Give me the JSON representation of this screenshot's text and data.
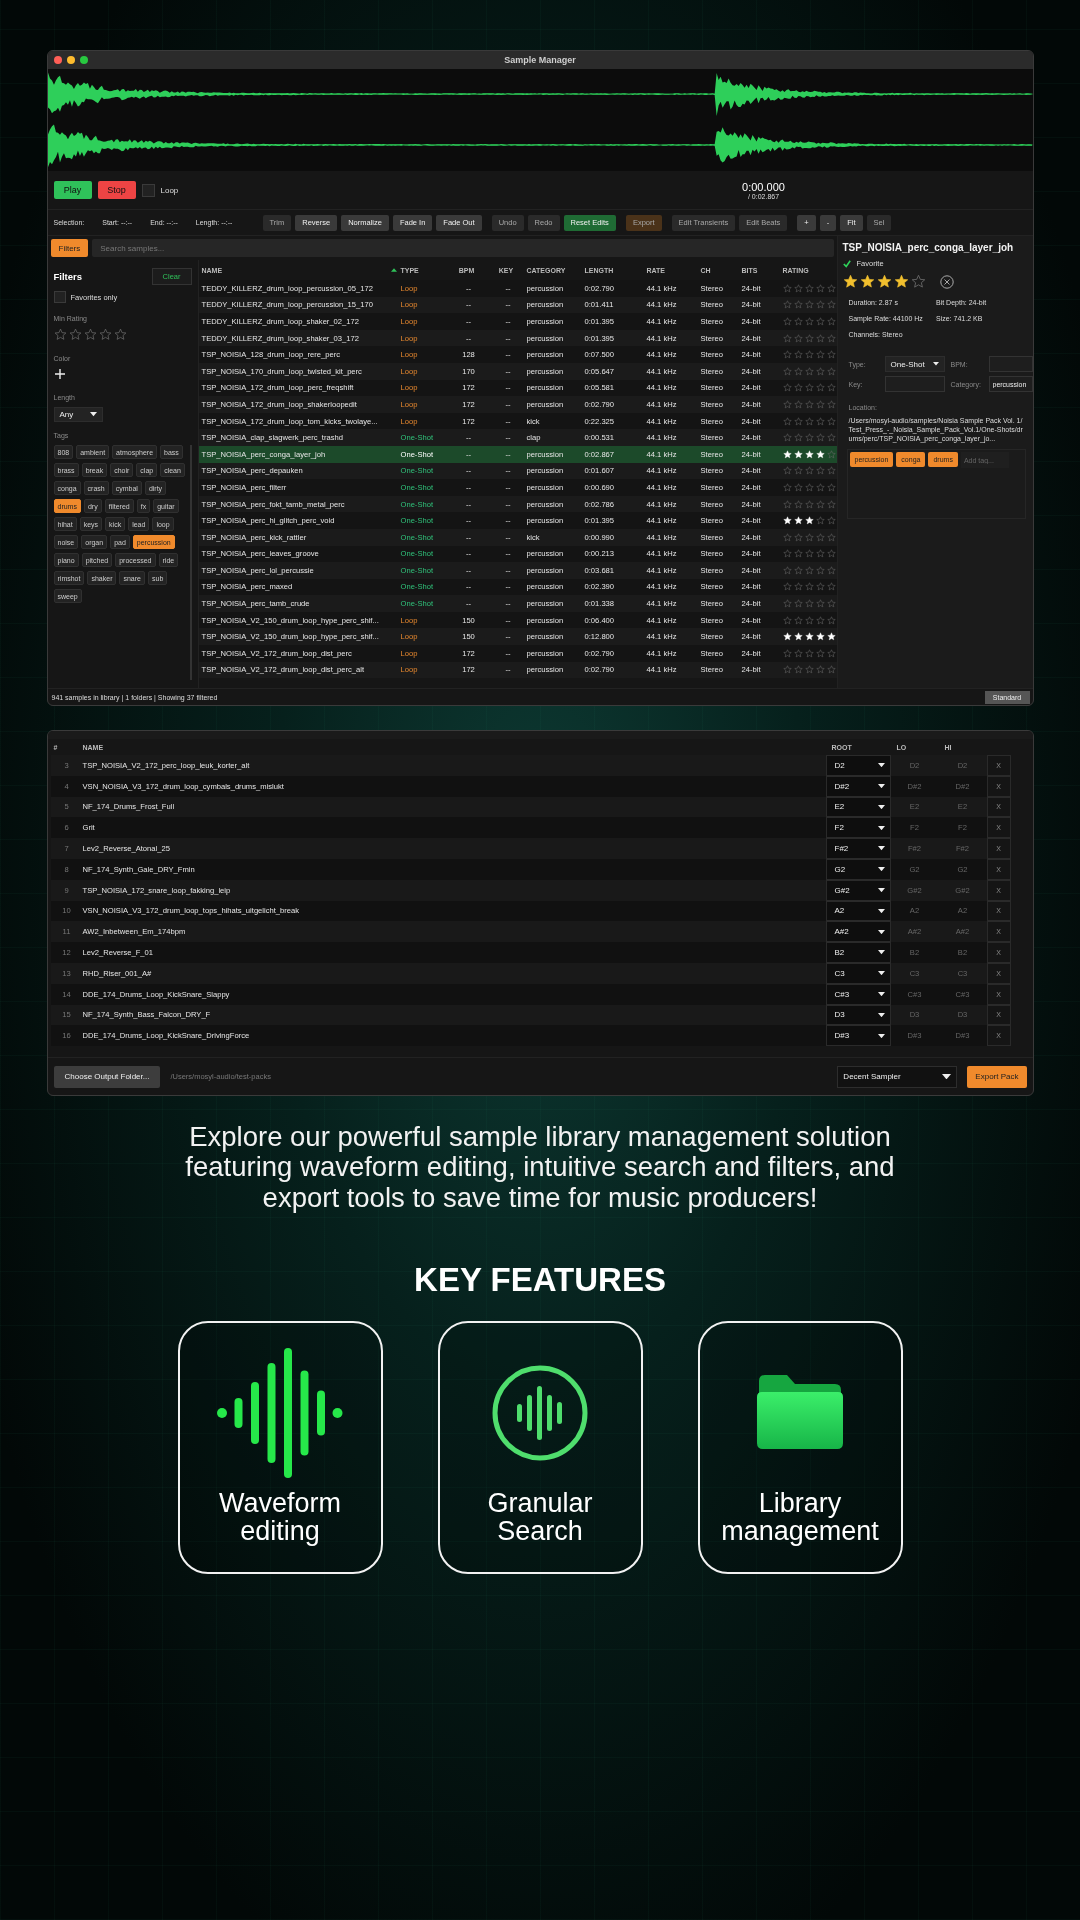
{
  "app": {
    "title": "Sample Manager",
    "transport": {
      "play": "Play",
      "stop": "Stop",
      "loop": {
        "label": "Loop",
        "checked": false
      },
      "time": "0:00.000",
      "duration": "/ 0:02.867"
    },
    "selection": {
      "label": "Selection:",
      "start": "Start: --:--",
      "end": "End: --:--",
      "length": "Length: --:--"
    },
    "tool_groups": [
      [
        {
          "label": "Trim",
          "kind": "plain",
          "disabled": true
        },
        {
          "label": "Reverse",
          "kind": "plain",
          "disabled": false
        },
        {
          "label": "Normalize",
          "kind": "plain",
          "disabled": false
        },
        {
          "label": "Fade In",
          "kind": "plain",
          "disabled": false
        },
        {
          "label": "Fade Out",
          "kind": "plain",
          "disabled": false
        }
      ],
      [
        {
          "label": "Undo",
          "kind": "plain",
          "disabled": true
        },
        {
          "label": "Redo",
          "kind": "plain",
          "disabled": true
        },
        {
          "label": "Reset Edits",
          "kind": "success",
          "disabled": false
        }
      ],
      [
        {
          "label": "Export",
          "kind": "warning",
          "disabled": true
        }
      ],
      [
        {
          "label": "Edit Transients",
          "kind": "plain",
          "disabled": true
        },
        {
          "label": "Edit Beats",
          "kind": "plain",
          "disabled": true
        }
      ],
      [
        {
          "label": "+",
          "kind": "plain",
          "disabled": false
        },
        {
          "label": "-",
          "kind": "plain",
          "disabled": false
        },
        {
          "label": "Fit",
          "kind": "plain",
          "disabled": false
        },
        {
          "label": "Sel",
          "kind": "plain",
          "disabled": true
        }
      ]
    ],
    "filters_button": "Filters",
    "search": {
      "placeholder": "Search samples..."
    },
    "sidebar": {
      "title": "Filters",
      "clear": "Clear",
      "favorites": {
        "label": "Favorites only",
        "checked": false
      },
      "min_rating": {
        "label": "Min Rating",
        "stars": 0
      },
      "color": {
        "label": "Color"
      },
      "length": {
        "label": "Length",
        "value": "Any"
      },
      "tags_label": "Tags",
      "tags": [
        {
          "label": "808",
          "selected": false
        },
        {
          "label": "ambient",
          "selected": false
        },
        {
          "label": "atmosphere",
          "selected": false
        },
        {
          "label": "bass",
          "selected": false
        },
        {
          "label": "brass",
          "selected": false
        },
        {
          "label": "break",
          "selected": false
        },
        {
          "label": "choir",
          "selected": false
        },
        {
          "label": "clap",
          "selected": false
        },
        {
          "label": "clean",
          "selected": false
        },
        {
          "label": "conga",
          "selected": false
        },
        {
          "label": "crash",
          "selected": false
        },
        {
          "label": "cymbal",
          "selected": false
        },
        {
          "label": "dirty",
          "selected": false
        },
        {
          "label": "drums",
          "selected": true
        },
        {
          "label": "dry",
          "selected": false
        },
        {
          "label": "filtered",
          "selected": false
        },
        {
          "label": "fx",
          "selected": false
        },
        {
          "label": "guitar",
          "selected": false
        },
        {
          "label": "hihat",
          "selected": false
        },
        {
          "label": "keys",
          "selected": false
        },
        {
          "label": "kick",
          "selected": false
        },
        {
          "label": "lead",
          "selected": false
        },
        {
          "label": "loop",
          "selected": false
        },
        {
          "label": "noise",
          "selected": false
        },
        {
          "label": "organ",
          "selected": false
        },
        {
          "label": "pad",
          "selected": false
        },
        {
          "label": "percussion",
          "selected": true
        },
        {
          "label": "piano",
          "selected": false
        },
        {
          "label": "pitched",
          "selected": false
        },
        {
          "label": "processed",
          "selected": false
        },
        {
          "label": "ride",
          "selected": false
        },
        {
          "label": "rimshot",
          "selected": false
        },
        {
          "label": "shaker",
          "selected": false
        },
        {
          "label": "snare",
          "selected": false
        },
        {
          "label": "sub",
          "selected": false
        },
        {
          "label": "sweep",
          "selected": false
        }
      ]
    },
    "table": {
      "columns": [
        {
          "label": "NAME",
          "sorted": true
        },
        {
          "label": "TYPE",
          "sorted": false
        },
        {
          "label": "BPM",
          "sorted": false
        },
        {
          "label": "KEY",
          "sorted": false
        },
        {
          "label": "CATEGORY",
          "sorted": false
        },
        {
          "label": "LENGTH",
          "sorted": false
        },
        {
          "label": "RATE",
          "sorted": false
        },
        {
          "label": "CH",
          "sorted": false
        },
        {
          "label": "BITS",
          "sorted": false
        },
        {
          "label": "RATING",
          "sorted": false
        }
      ],
      "rows": [
        {
          "name": "TEDDY_KILLERZ_drum_loop_percussion_05_172",
          "type": "Loop",
          "kind": "loop",
          "bpm": "--",
          "key": "--",
          "category": "percussion",
          "length": "0:02.790",
          "rate": "44.1 kHz",
          "ch": "Stereo",
          "bits": "24-bit",
          "stars": 0,
          "selected": false
        },
        {
          "name": "TEDDY_KILLERZ_drum_loop_percussion_15_170",
          "type": "Loop",
          "kind": "loop",
          "bpm": "--",
          "key": "--",
          "category": "percussion",
          "length": "0:01.411",
          "rate": "44.1 kHz",
          "ch": "Stereo",
          "bits": "24-bit",
          "stars": 0,
          "selected": false
        },
        {
          "name": "TEDDY_KILLERZ_drum_loop_shaker_02_172",
          "type": "Loop",
          "kind": "loop",
          "bpm": "--",
          "key": "--",
          "category": "percussion",
          "length": "0:01.395",
          "rate": "44.1 kHz",
          "ch": "Stereo",
          "bits": "24-bit",
          "stars": 0,
          "selected": false
        },
        {
          "name": "TEDDY_KILLERZ_drum_loop_shaker_03_172",
          "type": "Loop",
          "kind": "loop",
          "bpm": "--",
          "key": "--",
          "category": "percussion",
          "length": "0:01.395",
          "rate": "44.1 kHz",
          "ch": "Stereo",
          "bits": "24-bit",
          "stars": 0,
          "selected": false
        },
        {
          "name": "TSP_NOISIA_128_drum_loop_rere_perc",
          "type": "Loop",
          "kind": "loop",
          "bpm": "128",
          "key": "--",
          "category": "percussion",
          "length": "0:07.500",
          "rate": "44.1 kHz",
          "ch": "Stereo",
          "bits": "24-bit",
          "stars": 0,
          "selected": false
        },
        {
          "name": "TSP_NOISIA_170_drum_loop_twisted_kit_perc",
          "type": "Loop",
          "kind": "loop",
          "bpm": "170",
          "key": "--",
          "category": "percussion",
          "length": "0:05.647",
          "rate": "44.1 kHz",
          "ch": "Stereo",
          "bits": "24-bit",
          "stars": 0,
          "selected": false
        },
        {
          "name": "TSP_NOISIA_172_drum_loop_perc_freqshift",
          "type": "Loop",
          "kind": "loop",
          "bpm": "172",
          "key": "--",
          "category": "percussion",
          "length": "0:05.581",
          "rate": "44.1 kHz",
          "ch": "Stereo",
          "bits": "24-bit",
          "stars": 0,
          "selected": false
        },
        {
          "name": "TSP_NOISIA_172_drum_loop_shakerloopedit",
          "type": "Loop",
          "kind": "loop",
          "bpm": "172",
          "key": "--",
          "category": "percussion",
          "length": "0:02.790",
          "rate": "44.1 kHz",
          "ch": "Stereo",
          "bits": "24-bit",
          "stars": 0,
          "selected": false
        },
        {
          "name": "TSP_NOISIA_172_drum_loop_tom_kicks_twolaye...",
          "type": "Loop",
          "kind": "loop",
          "bpm": "172",
          "key": "--",
          "category": "kick",
          "length": "0:22.325",
          "rate": "44.1 kHz",
          "ch": "Stereo",
          "bits": "24-bit",
          "stars": 0,
          "selected": false
        },
        {
          "name": "TSP_NOISIA_clap_slagwerk_perc_trashd",
          "type": "One-Shot",
          "kind": "one-shot",
          "bpm": "--",
          "key": "--",
          "category": "clap",
          "length": "0:00.531",
          "rate": "44.1 kHz",
          "ch": "Stereo",
          "bits": "24-bit",
          "stars": 0,
          "selected": false
        },
        {
          "name": "TSP_NOISIA_perc_conga_layer_joh",
          "type": "One-Shot",
          "kind": "one-shot",
          "bpm": "--",
          "key": "--",
          "category": "percussion",
          "length": "0:02.867",
          "rate": "44.1 kHz",
          "ch": "Stereo",
          "bits": "24-bit",
          "stars": 4,
          "selected": true
        },
        {
          "name": "TSP_NOISIA_perc_depauken",
          "type": "One-Shot",
          "kind": "one-shot",
          "bpm": "--",
          "key": "--",
          "category": "percussion",
          "length": "0:01.607",
          "rate": "44.1 kHz",
          "ch": "Stereo",
          "bits": "24-bit",
          "stars": 0,
          "selected": false
        },
        {
          "name": "TSP_NOISIA_perc_filterr",
          "type": "One-Shot",
          "kind": "one-shot",
          "bpm": "--",
          "key": "--",
          "category": "percussion",
          "length": "0:00.690",
          "rate": "44.1 kHz",
          "ch": "Stereo",
          "bits": "24-bit",
          "stars": 0,
          "selected": false
        },
        {
          "name": "TSP_NOISIA_perc_fokt_tamb_metal_perc",
          "type": "One-Shot",
          "kind": "one-shot",
          "bpm": "--",
          "key": "--",
          "category": "percussion",
          "length": "0:02.786",
          "rate": "44.1 kHz",
          "ch": "Stereo",
          "bits": "24-bit",
          "stars": 0,
          "selected": false
        },
        {
          "name": "TSP_NOISIA_perc_hi_glitch_perc_void",
          "type": "One-Shot",
          "kind": "one-shot",
          "bpm": "--",
          "key": "--",
          "category": "percussion",
          "length": "0:01.395",
          "rate": "44.1 kHz",
          "ch": "Stereo",
          "bits": "24-bit",
          "stars": 3,
          "selected": false
        },
        {
          "name": "TSP_NOISIA_perc_kick_rattler",
          "type": "One-Shot",
          "kind": "one-shot",
          "bpm": "--",
          "key": "--",
          "category": "kick",
          "length": "0:00.990",
          "rate": "44.1 kHz",
          "ch": "Stereo",
          "bits": "24-bit",
          "stars": 0,
          "selected": false
        },
        {
          "name": "TSP_NOISIA_perc_leaves_groove",
          "type": "One-Shot",
          "kind": "one-shot",
          "bpm": "--",
          "key": "--",
          "category": "percussion",
          "length": "0:00.213",
          "rate": "44.1 kHz",
          "ch": "Stereo",
          "bits": "24-bit",
          "stars": 0,
          "selected": false
        },
        {
          "name": "TSP_NOISIA_perc_lol_percussie",
          "type": "One-Shot",
          "kind": "one-shot",
          "bpm": "--",
          "key": "--",
          "category": "percussion",
          "length": "0:03.681",
          "rate": "44.1 kHz",
          "ch": "Stereo",
          "bits": "24-bit",
          "stars": 0,
          "selected": false
        },
        {
          "name": "TSP_NOISIA_perc_maxed",
          "type": "One-Shot",
          "kind": "one-shot",
          "bpm": "--",
          "key": "--",
          "category": "percussion",
          "length": "0:02.390",
          "rate": "44.1 kHz",
          "ch": "Stereo",
          "bits": "24-bit",
          "stars": 0,
          "selected": false
        },
        {
          "name": "TSP_NOISIA_perc_tamb_crude",
          "type": "One-Shot",
          "kind": "one-shot",
          "bpm": "--",
          "key": "--",
          "category": "percussion",
          "length": "0:01.338",
          "rate": "44.1 kHz",
          "ch": "Stereo",
          "bits": "24-bit",
          "stars": 0,
          "selected": false
        },
        {
          "name": "TSP_NOISIA_V2_150_drum_loop_hype_perc_shif...",
          "type": "Loop",
          "kind": "loop",
          "bpm": "150",
          "key": "--",
          "category": "percussion",
          "length": "0:06.400",
          "rate": "44.1 kHz",
          "ch": "Stereo",
          "bits": "24-bit",
          "stars": 0,
          "selected": false
        },
        {
          "name": "TSP_NOISIA_V2_150_drum_loop_hype_perc_shif...",
          "type": "Loop",
          "kind": "loop",
          "bpm": "150",
          "key": "--",
          "category": "percussion",
          "length": "0:12.800",
          "rate": "44.1 kHz",
          "ch": "Stereo",
          "bits": "24-bit",
          "stars": 5,
          "selected": false
        },
        {
          "name": "TSP_NOISIA_V2_172_drum_loop_dist_perc",
          "type": "Loop",
          "kind": "loop",
          "bpm": "172",
          "key": "--",
          "category": "percussion",
          "length": "0:02.790",
          "rate": "44.1 kHz",
          "ch": "Stereo",
          "bits": "24-bit",
          "stars": 0,
          "selected": false
        },
        {
          "name": "TSP_NOISIA_V2_172_drum_loop_dist_perc_alt",
          "type": "Loop",
          "kind": "loop",
          "bpm": "172",
          "key": "--",
          "category": "percussion",
          "length": "0:02.790",
          "rate": "44.1 kHz",
          "ch": "Stereo",
          "bits": "24-bit",
          "stars": 0,
          "selected": false
        }
      ]
    },
    "detail": {
      "title": "TSP_NOISIA_perc_conga_layer_joh",
      "favorite": {
        "label": "Favorite",
        "checked": true
      },
      "stars": 4,
      "info": [
        "Duration: 2.87 s",
        "Bit Depth: 24-bit",
        "Sample Rate: 44100 Hz",
        "Size: 741.2 KB",
        "Channels: Stereo"
      ],
      "type": {
        "label": "Type:",
        "value": "One-Shot"
      },
      "bpm": {
        "label": "BPM:"
      },
      "key": {
        "label": "Key:"
      },
      "category": {
        "label": "Category:",
        "value": "percussion"
      },
      "location": {
        "label": "Location:",
        "path": "/Users/mosyl-audio/samples/Noisia Sample Pack Vol. 1/Test_Press_-_Noisia_Sample_Pack_Vol.1/One-Shots/drums/perc/TSP_NOISIA_perc_conga_layer_jo..."
      },
      "tags": [
        "percussion",
        "conga",
        "drums"
      ],
      "add_tag": {
        "placeholder": "Add tag..."
      }
    },
    "status": {
      "text": "941 samples in library | 1 folders | Showing 37 filtered",
      "mode": "Standard"
    }
  },
  "pack": {
    "columns": [
      "#",
      "NAME",
      "ROOT",
      "LO",
      "HI"
    ],
    "rows": [
      {
        "num": "3",
        "name": "TSP_NOISIA_V2_172_perc_loop_leuk_korter_alt",
        "root": "D2",
        "lo": "D2",
        "hi": "D2",
        "remove": "X"
      },
      {
        "num": "4",
        "name": "VSN_NOISIA_V3_172_drum_loop_cymbals_drums_mislukt",
        "root": "D#2",
        "lo": "D#2",
        "hi": "D#2",
        "remove": "X"
      },
      {
        "num": "5",
        "name": "NF_174_Drums_Frost_Full",
        "root": "E2",
        "lo": "E2",
        "hi": "E2",
        "remove": "X"
      },
      {
        "num": "6",
        "name": "Grit",
        "root": "F2",
        "lo": "F2",
        "hi": "F2",
        "remove": "X"
      },
      {
        "num": "7",
        "name": "Lev2_Reverse_Atonal_25",
        "root": "F#2",
        "lo": "F#2",
        "hi": "F#2",
        "remove": "X"
      },
      {
        "num": "8",
        "name": "NF_174_Synth_Gale_DRY_Fmin",
        "root": "G2",
        "lo": "G2",
        "hi": "G2",
        "remove": "X"
      },
      {
        "num": "9",
        "name": "TSP_NOISIA_172_snare_loop_fakking_leip",
        "root": "G#2",
        "lo": "G#2",
        "hi": "G#2",
        "remove": "X"
      },
      {
        "num": "10",
        "name": "VSN_NOISIA_V3_172_drum_loop_tops_hihats_uitgelicht_break",
        "root": "A2",
        "lo": "A2",
        "hi": "A2",
        "remove": "X"
      },
      {
        "num": "11",
        "name": "AW2_Inbetween_Em_174bpm",
        "root": "A#2",
        "lo": "A#2",
        "hi": "A#2",
        "remove": "X"
      },
      {
        "num": "12",
        "name": "Lev2_Reverse_F_01",
        "root": "B2",
        "lo": "B2",
        "hi": "B2",
        "remove": "X"
      },
      {
        "num": "13",
        "name": "RHD_Riser_001_A#",
        "root": "C3",
        "lo": "C3",
        "hi": "C3",
        "remove": "X"
      },
      {
        "num": "14",
        "name": "DDE_174_Drums_Loop_KickSnare_Slappy",
        "root": "C#3",
        "lo": "C#3",
        "hi": "C#3",
        "remove": "X"
      },
      {
        "num": "15",
        "name": "NF_174_Synth_Bass_Falcon_DRY_F",
        "root": "D3",
        "lo": "D3",
        "hi": "D3",
        "remove": "X"
      },
      {
        "num": "16",
        "name": "DDE_174_Drums_Loop_KickSnare_DrivingForce",
        "root": "D#3",
        "lo": "D#3",
        "hi": "D#3",
        "remove": "X"
      }
    ],
    "folder_button": "Choose Output Folder...",
    "path": "/Users/mosyl-audio/test-packs",
    "format": "Decent Sampler",
    "export": "Export Pack"
  },
  "promo": {
    "text": "Explore our powerful sample library management solution featuring waveform editing, intuitive search and filters, and export tools to save time for music producers!",
    "heading": "KEY FEATURES",
    "features": [
      {
        "label": "Waveform editing",
        "kind": "waveform"
      },
      {
        "label": "Granular Search",
        "kind": "search"
      },
      {
        "label": "Library management",
        "kind": "folder"
      }
    ]
  }
}
